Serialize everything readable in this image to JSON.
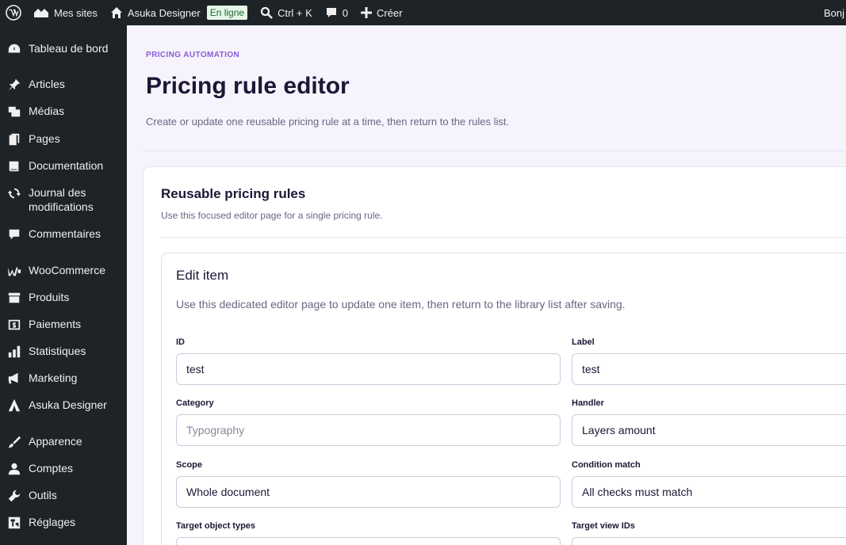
{
  "adminbar": {
    "my_sites": "Mes sites",
    "site_name": "Asuka Designer",
    "status_badge": "En ligne",
    "search_shortcut": "Ctrl + K",
    "comments_count": "0",
    "create": "Créer",
    "user": "Bonj"
  },
  "sidebar": {
    "items": [
      {
        "label": "Tableau de bord",
        "icon": "dashboard-icon"
      },
      {
        "label": "Articles",
        "icon": "pin-icon"
      },
      {
        "label": "Médias",
        "icon": "media-icon"
      },
      {
        "label": "Pages",
        "icon": "pages-icon"
      },
      {
        "label": "Documentation",
        "icon": "book-icon"
      },
      {
        "label": "Journal des modifications",
        "icon": "update-icon"
      },
      {
        "label": "Commentaires",
        "icon": "comment-icon"
      },
      {
        "label": "WooCommerce",
        "icon": "woocommerce-icon"
      },
      {
        "label": "Produits",
        "icon": "archive-icon"
      },
      {
        "label": "Paiements",
        "icon": "money-icon"
      },
      {
        "label": "Statistiques",
        "icon": "chart-icon"
      },
      {
        "label": "Marketing",
        "icon": "megaphone-icon"
      },
      {
        "label": "Asuka Designer",
        "icon": "asuka-icon"
      },
      {
        "label": "Apparence",
        "icon": "brush-icon"
      },
      {
        "label": "Comptes",
        "icon": "user-icon"
      },
      {
        "label": "Outils",
        "icon": "wrench-icon"
      },
      {
        "label": "Réglages",
        "icon": "settings-icon"
      }
    ]
  },
  "header": {
    "eyebrow": "PRICING AUTOMATION",
    "title": "Pricing rule editor",
    "description": "Create or update one reusable pricing rule at a time, then return to the rules list."
  },
  "card": {
    "title": "Reusable pricing rules",
    "description": "Use this focused editor page for a single pricing rule."
  },
  "editor": {
    "title": "Edit item",
    "description": "Use this dedicated editor page to update one item, then return to the library list after saving.",
    "fields": {
      "id": {
        "label": "ID",
        "value": "test"
      },
      "label": {
        "label": "Label",
        "value": "test"
      },
      "category": {
        "label": "Category",
        "value": "",
        "placeholder": "Typography"
      },
      "handler": {
        "label": "Handler",
        "value": "Layers amount"
      },
      "scope": {
        "label": "Scope",
        "value": "Whole document"
      },
      "condition_match": {
        "label": "Condition match",
        "value": "All checks must match"
      },
      "target_object_types": {
        "label": "Target object types",
        "value": ""
      },
      "target_view_ids": {
        "label": "Target view IDs",
        "value": ""
      }
    }
  },
  "colors": {
    "admin_bar": "#1d2327",
    "accent": "#8a5cd9",
    "title": "#1e1636",
    "badge_bg": "#e5f6e8"
  }
}
